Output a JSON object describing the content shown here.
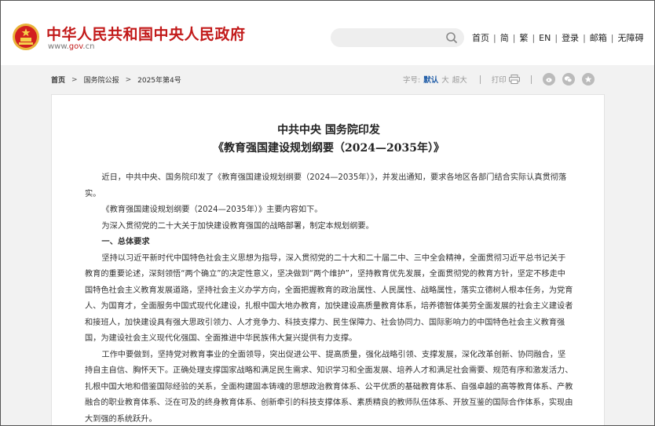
{
  "header": {
    "site_title": "中华人民共和国中央人民政府",
    "site_url_prefix": "www.",
    "site_url_brand": "gov",
    "site_url_suffix": ".cn",
    "search_placeholder": "",
    "links": {
      "home": "首页",
      "simplified": "简",
      "traditional": "繁",
      "english": "EN",
      "login": "登录",
      "mailbox": "邮箱",
      "accessibility": "无障碍"
    },
    "separator": "|",
    "emblem_icon": "national-emblem-icon",
    "accent_color": "#c21a1a"
  },
  "breadcrumb": {
    "home": "首页",
    "level1": "国务院公报",
    "level2": "2025年第4号",
    "chevron": ">"
  },
  "tools": {
    "font_size_label": "字号:",
    "font_default": "默认",
    "font_large": "大",
    "font_xlarge": "超大",
    "print_label": "打印",
    "share_icons": [
      "weibo-icon",
      "wechat-icon",
      "favorite-icon"
    ]
  },
  "article": {
    "title_line1": "中共中央  国务院印发",
    "title_line2": "《教育强国建设规划纲要（2024—2035年）》",
    "paragraphs": [
      "近日，中共中央、国务院印发了《教育强国建设规划纲要（2024—2035年）》，并发出通知，要求各地区各部门结合实际认真贯彻落实。",
      "《教育强国建设规划纲要（2024—2035年）》主要内容如下。",
      "为深入贯彻党的二十大关于加快建设教育强国的战略部署，制定本规划纲要。",
      "一、总体要求",
      "坚持以习近平新时代中国特色社会主义思想为指导，深入贯彻党的二十大和二十届二中、三中全会精神，全面贯彻习近平总书记关于教育的重要论述，深刻领悟“两个确立”的决定性意义，坚决做到“两个维护”，坚持教育优先发展，全面贯彻党的教育方针，坚定不移走中国特色社会主义教育发展道路，坚持社会主义办学方向，全面把握教育的政治属性、人民属性、战略属性，落实立德树人根本任务，为党育人、为国育才，全面服务中国式现代化建设，扎根中国大地办教育，加快建设高质量教育体系，培养德智体美劳全面发展的社会主义建设者和接班人，加快建设具有强大思政引领力、人才竞争力、科技支撑力、民生保障力、社会协同力、国际影响力的中国特色社会主义教育强国，为建设社会主义现代化强国、全面推进中华民族伟大复兴提供有力支撑。",
      "工作中要做到，坚持党对教育事业的全面领导，突出促进公平、提高质量，强化战略引领、支撑发展，深化改革创新、协同融合，坚持自主自信、胸怀天下。正确处理支撑国家战略和满足民生需求、知识学习和全面发展、培养人才和满足社会需要、规范有序和激发活力、扎根中国大地和借鉴国际经验的关系，全面构建固本铸魂的思想政治教育体系、公平优质的基础教育体系、自强卓越的高等教育体系、产教融合的职业教育体系、泛在可及的终身教育体系、创新牵引的科技支撑体系、素质精良的教师队伍体系、开放互鉴的国际合作体系，实现由大到强的系统跃升。"
    ]
  }
}
